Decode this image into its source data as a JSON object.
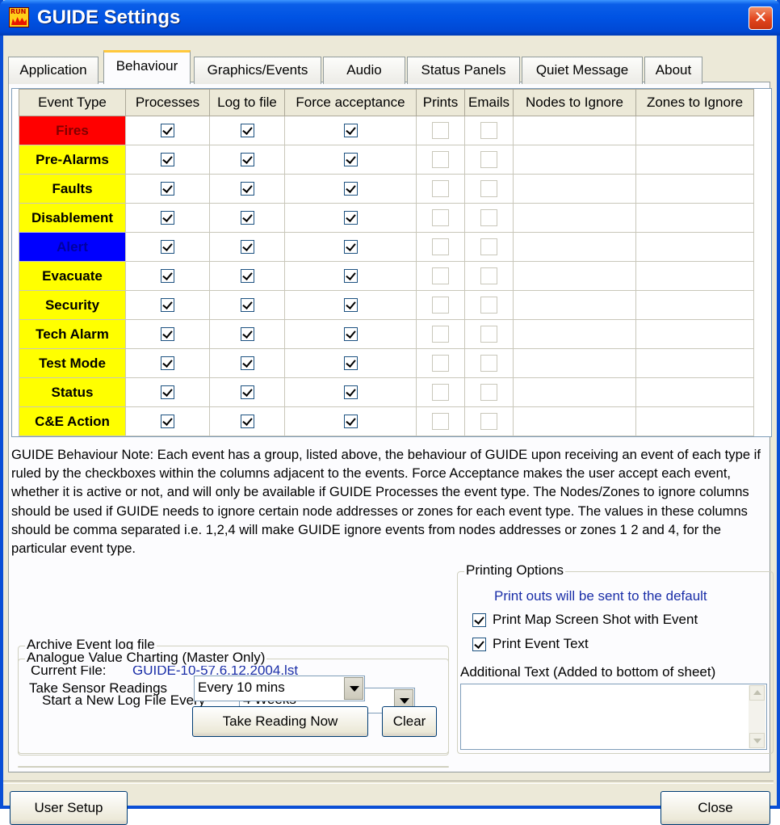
{
  "window": {
    "title": "GUIDE Settings",
    "icon_text": "RUN"
  },
  "tabs": [
    {
      "label": "Application",
      "active": false
    },
    {
      "label": "Behaviour",
      "active": true
    },
    {
      "label": "Graphics/Events",
      "active": false
    },
    {
      "label": "Audio",
      "active": false
    },
    {
      "label": "Status Panels",
      "active": false
    },
    {
      "label": "Quiet Message",
      "active": false
    },
    {
      "label": "About",
      "active": false
    }
  ],
  "grid": {
    "headers": [
      "Event Type",
      "Processes",
      "Log to file",
      "Force acceptance",
      "Prints",
      "Emails",
      "Nodes to Ignore",
      "Zones to Ignore"
    ],
    "rows": [
      {
        "event": "Fires",
        "color": "#ff0000",
        "processes": true,
        "log": true,
        "force": true,
        "prints": false,
        "emails": false,
        "nodes": "",
        "zones": ""
      },
      {
        "event": "Pre-Alarms",
        "color": "#ffff00",
        "processes": true,
        "log": true,
        "force": true,
        "prints": false,
        "emails": false,
        "nodes": "",
        "zones": ""
      },
      {
        "event": "Faults",
        "color": "#ffff00",
        "processes": true,
        "log": true,
        "force": true,
        "prints": false,
        "emails": false,
        "nodes": "",
        "zones": ""
      },
      {
        "event": "Disablement",
        "color": "#ffff00",
        "processes": true,
        "log": true,
        "force": true,
        "prints": false,
        "emails": false,
        "nodes": "",
        "zones": ""
      },
      {
        "event": "Alert",
        "color": "#0000ff",
        "processes": true,
        "log": true,
        "force": true,
        "prints": false,
        "emails": false,
        "nodes": "",
        "zones": ""
      },
      {
        "event": "Evacuate",
        "color": "#ffff00",
        "processes": true,
        "log": true,
        "force": true,
        "prints": false,
        "emails": false,
        "nodes": "",
        "zones": ""
      },
      {
        "event": "Security",
        "color": "#ffff00",
        "processes": true,
        "log": true,
        "force": true,
        "prints": false,
        "emails": false,
        "nodes": "",
        "zones": ""
      },
      {
        "event": "Tech Alarm",
        "color": "#ffff00",
        "processes": true,
        "log": true,
        "force": true,
        "prints": false,
        "emails": false,
        "nodes": "",
        "zones": ""
      },
      {
        "event": "Test Mode",
        "color": "#ffff00",
        "processes": true,
        "log": true,
        "force": true,
        "prints": false,
        "emails": false,
        "nodes": "",
        "zones": ""
      },
      {
        "event": "Status",
        "color": "#ffff00",
        "processes": true,
        "log": true,
        "force": true,
        "prints": false,
        "emails": false,
        "nodes": "",
        "zones": ""
      },
      {
        "event": "C&E Action",
        "color": "#ffff00",
        "processes": true,
        "log": true,
        "force": true,
        "prints": false,
        "emails": false,
        "nodes": "",
        "zones": ""
      }
    ]
  },
  "note": "GUIDE Behaviour Note: Each event has a group, listed above, the behaviour of GUIDE upon receiving an event of each type if ruled by the checkboxes within the columns adjacent to the events. Force Acceptance makes the user accept each event, whether it is active or not, and will only be available if GUIDE Processes the event type. The Nodes/Zones to ignore columns should be used if GUIDE needs to ignore certain node addresses or zones for each event type. The values in these columns should be comma separated i.e.  1,2,4 will make GUIDE ignore events from nodes addresses or zones 1 2 and 4, for the particular event type.",
  "archive": {
    "legend": "Archive Event log file",
    "current_file_label": "Current File:",
    "current_file_value": "GUIDE-10-57.6.12.2004.lst",
    "new_log_label": "Start a New Log File Every",
    "new_log_value": "4 Weeks"
  },
  "charting": {
    "legend": "Analogue Value Charting (Master Only)",
    "sensor_label": "Take Sensor Readings",
    "sensor_value": "Every 10 mins",
    "take_reading_button": "Take Reading Now",
    "clear_button": "Clear"
  },
  "printing": {
    "legend": "Printing Options",
    "default_note": "Print outs will be sent to the default",
    "map_screenshot_label": "Print Map Screen Shot with Event",
    "map_screenshot_checked": true,
    "event_text_label": "Print Event Text",
    "event_text_checked": true,
    "additional_text_label": "Additional Text (Added to bottom of sheet)",
    "additional_text_value": ""
  },
  "footer": {
    "user_setup_button": "User Setup",
    "close_button": "Close"
  },
  "colors": {
    "title_bar": "#0053e3",
    "tab_highlight": "#ffc83c",
    "link_text": "#1a2ea8"
  }
}
